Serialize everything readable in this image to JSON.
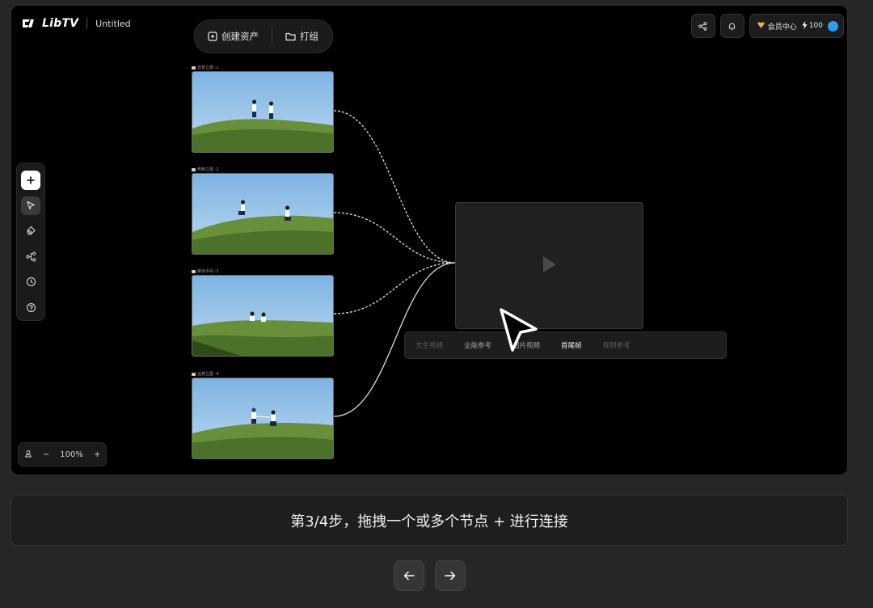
{
  "app": {
    "brand": "LibTV",
    "doc_title": "Untitled"
  },
  "top_pill": {
    "create_asset": "创建资产",
    "group": "打组"
  },
  "header_right": {
    "member_center": "会员中心",
    "credits": "100",
    "avatar_color": "#2f9bf0",
    "member_icon_color": "#f4a93a"
  },
  "toolbar": {
    "tools": [
      "add-icon",
      "select-icon",
      "shapes-icon",
      "workflow-icon",
      "history-icon",
      "help-icon"
    ]
  },
  "zoom": {
    "level": "100%",
    "minus": "−",
    "plus": "+"
  },
  "nodes": [
    {
      "label": "远景立图 -1"
    },
    {
      "label": "奔跑立图 -2"
    },
    {
      "label": "聚坐中间 -3"
    },
    {
      "label": "远景立图 -4"
    }
  ],
  "mode_bar": {
    "tabs": [
      "文生视频",
      "全能参考",
      "图片视频",
      "首尾帧",
      "视频参考"
    ],
    "selected": "首尾帧"
  },
  "step": {
    "text": "第3/4步，拖拽一个或多个节点 + 进行连接"
  },
  "nav": {
    "prev": "←",
    "next": "→"
  }
}
